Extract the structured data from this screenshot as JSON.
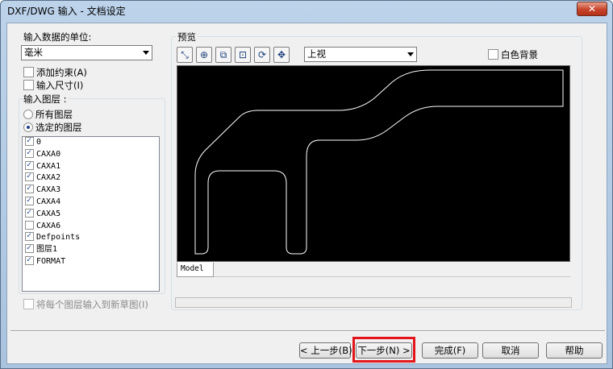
{
  "window": {
    "title": "DXF/DWG 输入 - 文档设定",
    "close_label": "✕"
  },
  "units": {
    "label": "输入数据的单位:",
    "selected": "毫米"
  },
  "options": {
    "add_constraints": "添加约束(A)",
    "import_dimensions": "输入尺寸(I)"
  },
  "layers": {
    "group_label": "输入图层 :",
    "radio_all": "所有图层",
    "radio_selected": "选定的图层",
    "items": [
      {
        "name": "0",
        "checked": true
      },
      {
        "name": "CAXA0",
        "checked": true
      },
      {
        "name": "CAXA1",
        "checked": true
      },
      {
        "name": "CAXA2",
        "checked": true
      },
      {
        "name": "CAXA3",
        "checked": true
      },
      {
        "name": "CAXA4",
        "checked": true
      },
      {
        "name": "CAXA5",
        "checked": true
      },
      {
        "name": "CAXA6",
        "checked": false
      },
      {
        "name": "Defpoints",
        "checked": true
      },
      {
        "name": "图层1",
        "checked": true
      },
      {
        "name": "FORMAT",
        "checked": true
      }
    ],
    "each_to_new_sketch": "将每个图层输入到新草图(I)"
  },
  "preview": {
    "label": "预览",
    "view_selected": "上视",
    "white_background": "白色背景",
    "model_tab": "Model",
    "tool_icons": [
      "select-icon",
      "zoom-in-icon",
      "zoom-window-icon",
      "zoom-fit-icon",
      "rotate-icon",
      "pan-icon"
    ]
  },
  "buttons": {
    "back": "< 上一步(B)",
    "next": "下一步(N) >",
    "finish": "完成(F)",
    "cancel": "取消",
    "help": "帮助"
  },
  "colors": {
    "highlight": "#e3151a",
    "preview_bg": "#000000",
    "drawing_line": "#ffffff"
  }
}
